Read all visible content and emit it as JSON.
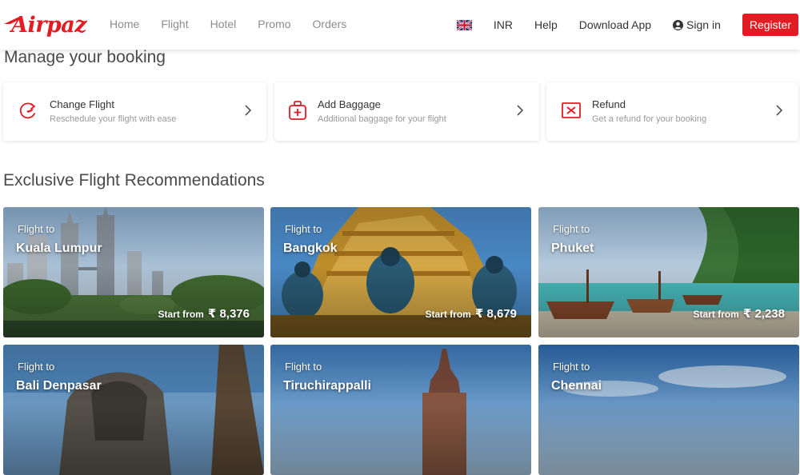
{
  "header": {
    "logo": "airpaz",
    "logo_display": "Airpaz",
    "nav": [
      {
        "label": "Home"
      },
      {
        "label": "Flight"
      },
      {
        "label": "Hotel"
      },
      {
        "label": "Promo"
      },
      {
        "label": "Orders"
      }
    ],
    "currency": "INR",
    "help": "Help",
    "download": "Download App",
    "signin": "Sign in",
    "register": "Register",
    "language_icon": "uk-flag-icon"
  },
  "booking": {
    "title": "Manage your booking",
    "cards": [
      {
        "title": "Change Flight",
        "subtitle": "Reschedule your flight with ease",
        "icon": "reschedule-icon"
      },
      {
        "title": "Add Baggage",
        "subtitle": "Additional baggage for your flight",
        "icon": "baggage-icon"
      },
      {
        "title": "Refund",
        "subtitle": "Get a refund for your booking",
        "icon": "refund-icon"
      }
    ]
  },
  "recommendations": {
    "title": "Exclusive Flight Recommendations",
    "cards": [
      {
        "prefix": "Flight to",
        "city": "Kuala Lumpur",
        "price_label": "Start from",
        "price": "₹ 8,376"
      },
      {
        "prefix": "Flight to",
        "city": "Bangkok",
        "price_label": "Start from",
        "price": "₹ 8,679"
      },
      {
        "prefix": "Flight to",
        "city": "Phuket",
        "price_label": "Start from",
        "price": "₹ 2,238"
      },
      {
        "prefix": "Flight to",
        "city": "Bali Denpasar"
      },
      {
        "prefix": "Flight to",
        "city": "Tiruchirappalli"
      },
      {
        "prefix": "Flight to",
        "city": "Chennai"
      }
    ]
  },
  "colors": {
    "brand": "#e31b23",
    "nav_text": "#8c8c8c",
    "title_text": "#4a4a4a"
  }
}
